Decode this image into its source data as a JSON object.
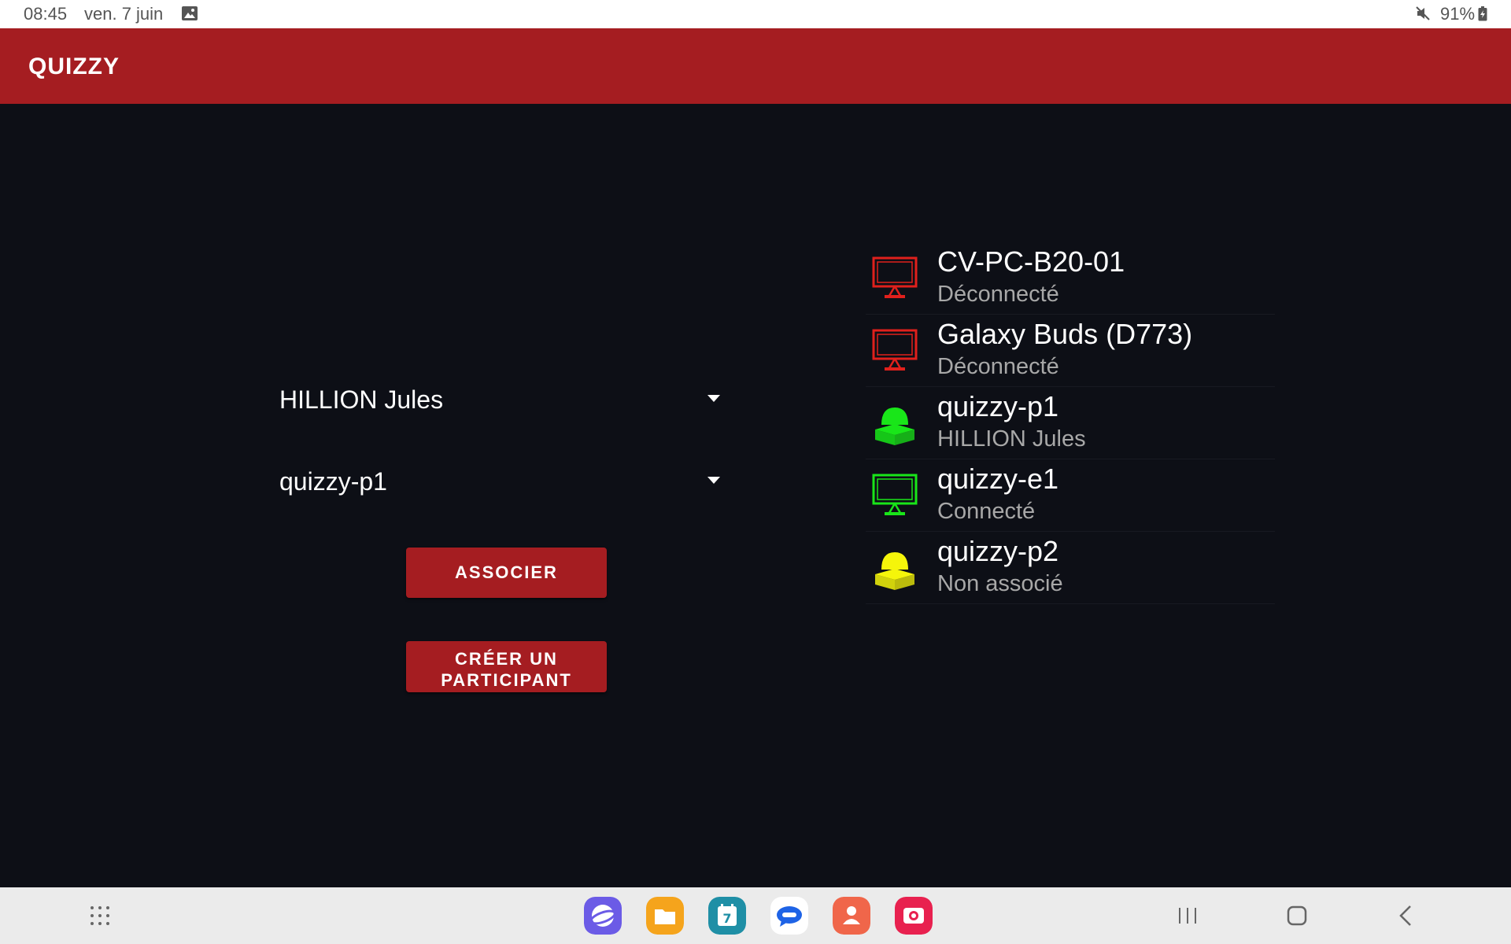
{
  "status_bar": {
    "time": "08:45",
    "date": "ven. 7 juin",
    "battery": "91%",
    "icons": [
      "image-notification-icon",
      "mute-icon",
      "battery-icon"
    ]
  },
  "app_bar": {
    "title": "QUIZZY",
    "color": "#a51d21"
  },
  "form": {
    "participant_select": {
      "value": "HILLION Jules"
    },
    "device_select": {
      "value": "quizzy-p1"
    },
    "associate_button": "ASSOCIER",
    "create_participant_button": "CRÉER UN\nPARTICIPANT"
  },
  "devices": [
    {
      "name": "CV-PC-B20-01",
      "status": "Déconnecté",
      "icon": "monitor-icon",
      "color": "#e0201c"
    },
    {
      "name": "Galaxy Buds (D773)",
      "status": "Déconnecté",
      "icon": "monitor-icon",
      "color": "#e0201c"
    },
    {
      "name": "quizzy-p1",
      "status": "HILLION Jules",
      "icon": "buzzer-icon",
      "color": "#19e619"
    },
    {
      "name": "quizzy-e1",
      "status": "Connecté",
      "icon": "monitor-icon",
      "color": "#19e619"
    },
    {
      "name": "quizzy-p2",
      "status": "Non associé",
      "icon": "buzzer-icon",
      "color": "#f5f50a"
    }
  ],
  "nav_bar": {
    "dock_apps": [
      "internet-app-icon",
      "files-app-icon",
      "calendar-app-icon",
      "messages-app-icon",
      "contacts-app-icon",
      "camera-app-icon"
    ],
    "calendar_day": "7"
  }
}
